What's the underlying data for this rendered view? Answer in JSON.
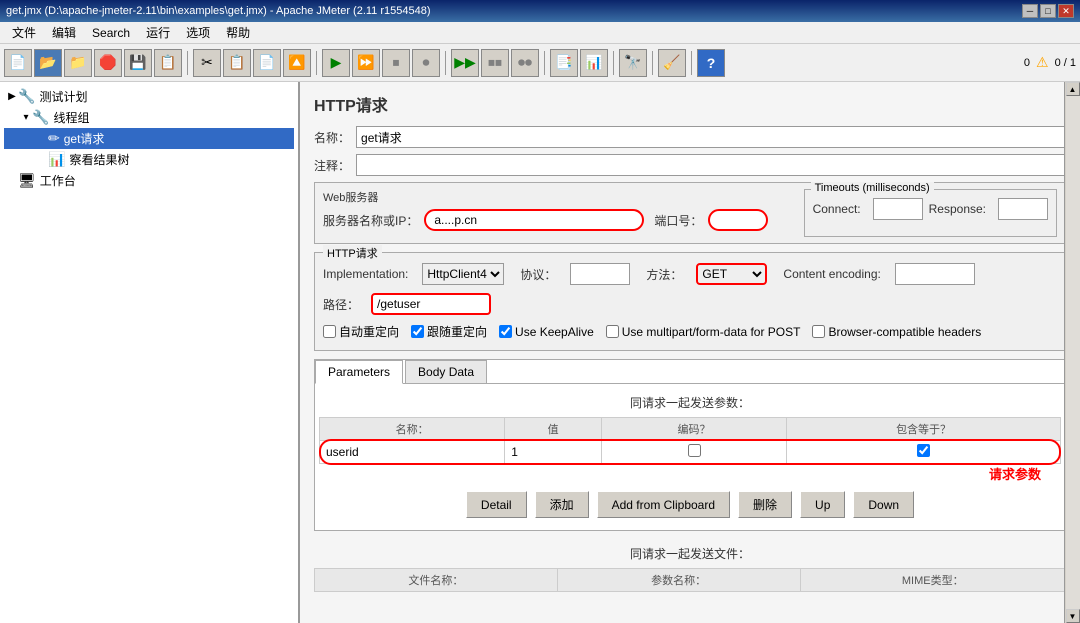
{
  "titleBar": {
    "text": "get.jmx (D:\\apache-jmeter-2.11\\bin\\examples\\get.jmx) - Apache JMeter (2.11 r1554548)"
  },
  "menuBar": {
    "items": [
      "文件",
      "编辑",
      "Search",
      "运行",
      "选项",
      "帮助"
    ]
  },
  "toolbar": {
    "warningCount": "0",
    "warningIcon": "⚠",
    "runCount": "0 / 1"
  },
  "tree": {
    "items": [
      {
        "label": "测试计划",
        "level": 0,
        "icon": "🔧",
        "expand": "▶"
      },
      {
        "label": "线程组",
        "level": 1,
        "icon": "🔧",
        "expand": "▾"
      },
      {
        "label": "get请求",
        "level": 2,
        "icon": "✏",
        "expand": "",
        "selected": true
      },
      {
        "label": "察看结果树",
        "level": 2,
        "icon": "📊",
        "expand": ""
      },
      {
        "label": "工作台",
        "level": 0,
        "icon": "🖥",
        "expand": ""
      }
    ]
  },
  "rightPanel": {
    "title": "HTTP请求",
    "nameLabel": "名称：",
    "nameValue": "get请求",
    "commentLabel": "注释：",
    "webServerTitle": "Web服务器",
    "serverNameLabel": "服务器名称或IP：",
    "serverNameValue": "a....p.cn",
    "portLabel": "端口号：",
    "portValue": "",
    "timeoutsTitle": "Timeouts (milliseconds)",
    "connectLabel": "Connect:",
    "connectValue": "",
    "responseLabel": "Response:",
    "responseValue": "",
    "httpRequestTitle": "HTTP请求",
    "implementationLabel": "Implementation:",
    "implementationValue": "HttpClient4",
    "protocolLabel": "协议：",
    "protocolValue": "",
    "methodLabel": "方法：",
    "methodValue": "GET",
    "contentEncodingLabel": "Content encoding:",
    "contentEncodingValue": "",
    "pathLabel": "路径：",
    "pathValue": "/getuser",
    "checkboxes": [
      {
        "label": "自动重定向",
        "checked": false
      },
      {
        "label": "跟随重定向",
        "checked": true
      },
      {
        "label": "Use KeepAlive",
        "checked": true
      },
      {
        "label": "Use multipart/form-data for POST",
        "checked": false
      },
      {
        "label": "Browser-compatible headers",
        "checked": false
      }
    ],
    "tabs": [
      "Parameters",
      "Body Data"
    ],
    "activeTab": "Parameters",
    "paramsHeader": "同请求一起发送参数：",
    "tableHeaders": [
      "名称：",
      "值",
      "编码？",
      "包含等于？"
    ],
    "tableRows": [
      {
        "name": "userid",
        "value": "1",
        "encode": false,
        "include": true
      }
    ],
    "reqParamLabel": "请求参数",
    "buttons": [
      "Detail",
      "添加",
      "Add from Clipboard",
      "删除",
      "Up",
      "Down"
    ],
    "filesHeader": "同请求一起发送文件：",
    "fileTableHeaders": [
      "文件名称：",
      "参数名称：",
      "MIME类型："
    ]
  }
}
